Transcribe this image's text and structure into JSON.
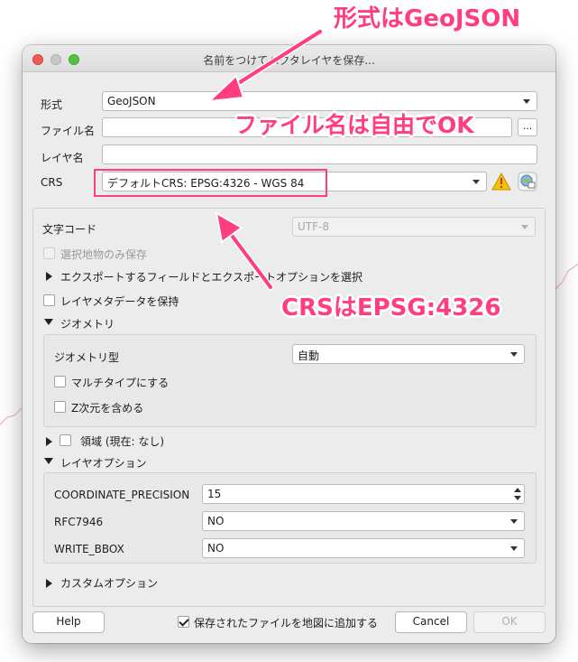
{
  "window": {
    "title": "名前をつけてベクタレイヤを保存..."
  },
  "form": {
    "format_label": "形式",
    "format_value": "GeoJSON",
    "filename_label": "ファイル名",
    "filename_value": "",
    "browse_label": "...",
    "layername_label": "レイヤ名",
    "layername_value": "",
    "crs_label": "CRS",
    "crs_value": "デフォルトCRS: EPSG:4326 - WGS 84"
  },
  "options": {
    "encoding_label": "文字コード",
    "encoding_value": "UTF-8",
    "selected_only_label": "選択地物のみ保存",
    "export_fields_label": "エクスポートするフィールドとエクスポートオプションを選択",
    "keep_metadata_label": "レイヤメタデータを保持",
    "geometry_section_label": "ジオメトリ",
    "geometry_type_label": "ジオメトリ型",
    "geometry_type_value": "自動",
    "multitype_label": "マルチタイプにする",
    "include_z_label": "Z次元を含める",
    "extent_label": "領域 (現在: なし)",
    "layer_options_label": "レイヤオプション",
    "custom_options_label": "カスタムオプション"
  },
  "layer_options": [
    {
      "key": "COORDINATE_PRECISION",
      "value": "15"
    },
    {
      "key": "RFC7946",
      "value": "NO"
    },
    {
      "key": "WRITE_BBOX",
      "value": "NO"
    }
  ],
  "footer": {
    "help_label": "Help",
    "add_to_map_label": "保存されたファイルを地図に追加する",
    "cancel_label": "Cancel",
    "ok_label": "OK"
  },
  "annotations": {
    "format_note": "形式はGeoJSON",
    "filename_note": "ファイル名は自由でOK",
    "crs_note": "CRSはEPSG:4326"
  },
  "colors": {
    "annotation": "#ff3d7f",
    "window_bg": "#ececec"
  }
}
